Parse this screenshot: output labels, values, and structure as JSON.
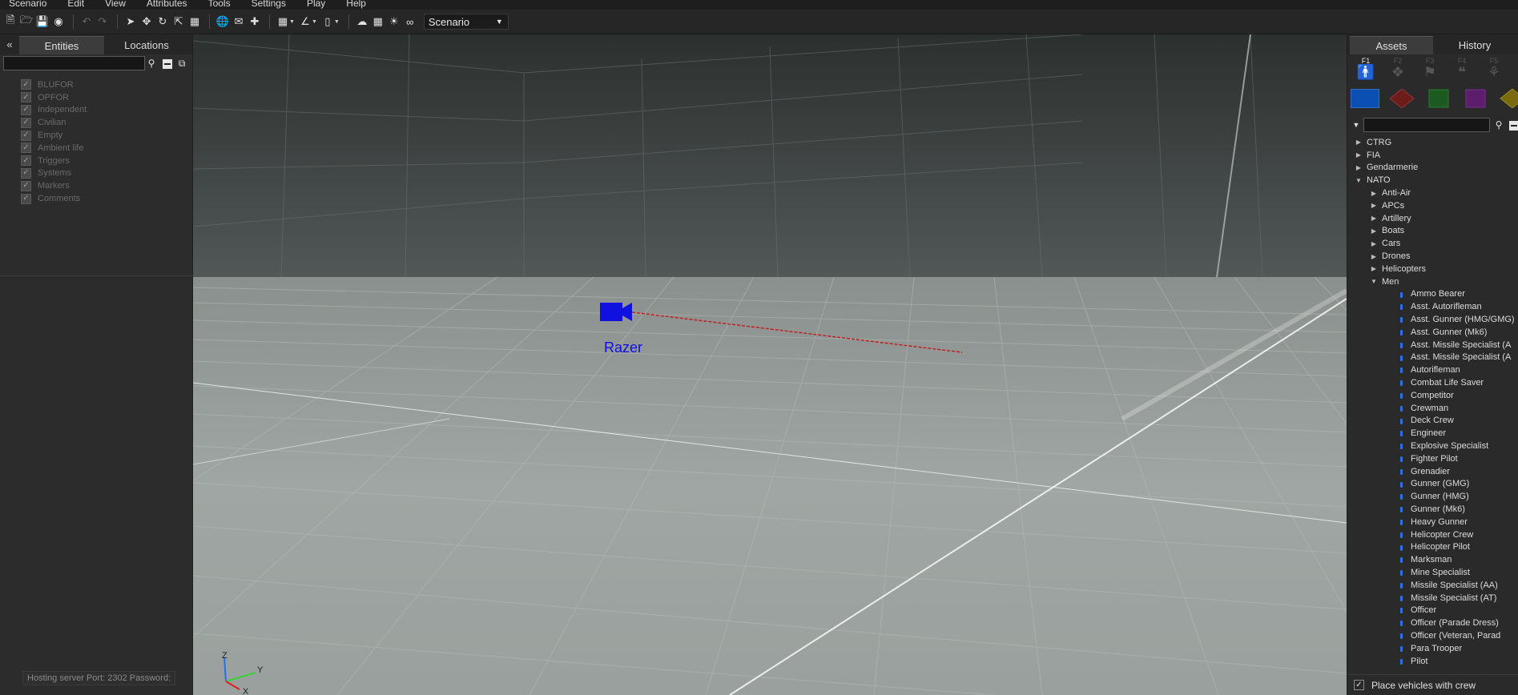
{
  "menubar": [
    "Scenario",
    "Edit",
    "View",
    "Attributes",
    "Tools",
    "Settings",
    "Play",
    "Help"
  ],
  "toolbar": {
    "scenario_select": "Scenario"
  },
  "left_panel": {
    "collapse_label": "«",
    "tabs": [
      "Entities",
      "Locations"
    ],
    "entities": [
      "BLUFOR",
      "OPFOR",
      "Independent",
      "Civilian",
      "Empty",
      "Ambient life",
      "Triggers",
      "Systems",
      "Markers",
      "Comments"
    ]
  },
  "status": "Hosting server   Port: 2302 Password:",
  "viewport": {
    "camera_label": "Razer",
    "camera_color": "#1010e0",
    "axis": {
      "z": "Z",
      "y": "Y",
      "x": "X"
    }
  },
  "right_panel": {
    "tabs": [
      "Assets",
      "History"
    ],
    "ftabs": [
      "F1",
      "F2",
      "F3",
      "F4",
      "F5"
    ],
    "sides_colors": [
      "#0b4fb3",
      "#6e1b1b",
      "#1d5a22",
      "#5c1d6d",
      "#7a6a10"
    ],
    "tree": [
      {
        "label": "CTRG",
        "level": 0,
        "state": "collapsed"
      },
      {
        "label": "FIA",
        "level": 0,
        "state": "collapsed"
      },
      {
        "label": "Gendarmerie",
        "level": 0,
        "state": "collapsed"
      },
      {
        "label": "NATO",
        "level": 0,
        "state": "expanded"
      },
      {
        "label": "Anti-Air",
        "level": 1,
        "state": "collapsed"
      },
      {
        "label": "APCs",
        "level": 1,
        "state": "collapsed"
      },
      {
        "label": "Artillery",
        "level": 1,
        "state": "collapsed"
      },
      {
        "label": "Boats",
        "level": 1,
        "state": "collapsed"
      },
      {
        "label": "Cars",
        "level": 1,
        "state": "collapsed"
      },
      {
        "label": "Drones",
        "level": 1,
        "state": "collapsed"
      },
      {
        "label": "Helicopters",
        "level": 1,
        "state": "collapsed"
      },
      {
        "label": "Men",
        "level": 1,
        "state": "expanded"
      },
      {
        "label": "Ammo Bearer",
        "level": 2
      },
      {
        "label": "Asst. Autorifleman",
        "level": 2
      },
      {
        "label": "Asst. Gunner (HMG/GMG)",
        "level": 2
      },
      {
        "label": "Asst. Gunner (Mk6)",
        "level": 2
      },
      {
        "label": "Asst. Missile Specialist (A",
        "level": 2
      },
      {
        "label": "Asst. Missile Specialist (A",
        "level": 2
      },
      {
        "label": "Autorifleman",
        "level": 2
      },
      {
        "label": "Combat Life Saver",
        "level": 2
      },
      {
        "label": "Competitor",
        "level": 2
      },
      {
        "label": "Crewman",
        "level": 2
      },
      {
        "label": "Deck Crew",
        "level": 2
      },
      {
        "label": "Engineer",
        "level": 2
      },
      {
        "label": "Explosive Specialist",
        "level": 2
      },
      {
        "label": "Fighter Pilot",
        "level": 2
      },
      {
        "label": "Grenadier",
        "level": 2
      },
      {
        "label": "Gunner (GMG)",
        "level": 2
      },
      {
        "label": "Gunner (HMG)",
        "level": 2
      },
      {
        "label": "Gunner (Mk6)",
        "level": 2
      },
      {
        "label": "Heavy Gunner",
        "level": 2
      },
      {
        "label": "Helicopter Crew",
        "level": 2
      },
      {
        "label": "Helicopter Pilot",
        "level": 2
      },
      {
        "label": "Marksman",
        "level": 2
      },
      {
        "label": "Mine Specialist",
        "level": 2
      },
      {
        "label": "Missile Specialist (AA)",
        "level": 2
      },
      {
        "label": "Missile Specialist (AT)",
        "level": 2
      },
      {
        "label": "Officer",
        "level": 2
      },
      {
        "label": "Officer (Parade Dress)",
        "level": 2
      },
      {
        "label": "Officer (Veteran, Parad",
        "level": 2
      },
      {
        "label": "Para Trooper",
        "level": 2
      },
      {
        "label": "Pilot",
        "level": 2
      }
    ],
    "crew_label": "Place vehicles with crew"
  }
}
